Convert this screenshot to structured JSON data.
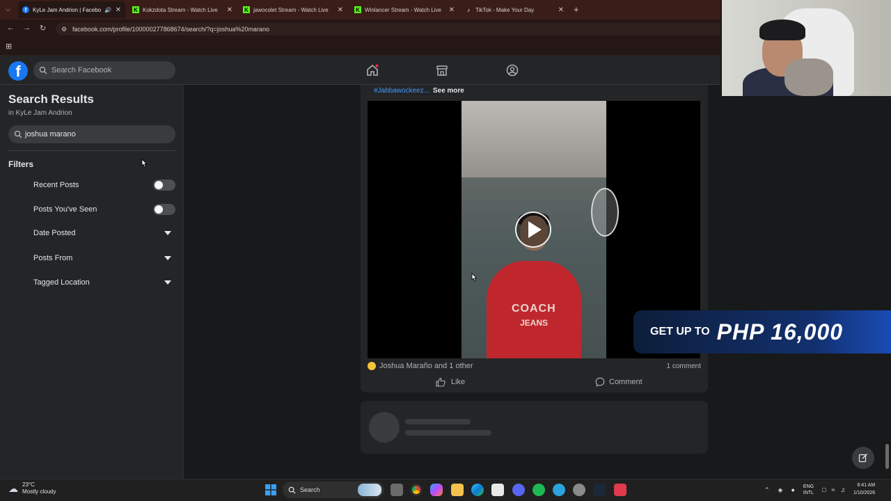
{
  "browser": {
    "tabs": [
      {
        "label": "KyLe Jam Andrion | Facebo",
        "active": true,
        "icon": "facebook-icon"
      },
      {
        "label": "Kokzdota Stream - Watch Live",
        "active": false,
        "icon": "kick-icon"
      },
      {
        "label": "jawocolet Stream - Watch Live",
        "active": false,
        "icon": "kick-icon"
      },
      {
        "label": "Winlancer Stream - Watch Live",
        "active": false,
        "icon": "kick-icon"
      },
      {
        "label": "TikTok - Make Your Day",
        "active": false,
        "icon": "tiktok-icon"
      }
    ],
    "new_tab": "+",
    "url": "facebook.com/profile/100000277868674/search/?q=joshua%20marano"
  },
  "header": {
    "logo": "f",
    "search_placeholder": "Search Facebook"
  },
  "sidebar": {
    "title": "Search Results",
    "subtitle": "in KyLe Jam Andrion",
    "search_value": "joshua marano",
    "filters_heading": "Filters",
    "filters": [
      {
        "label": "Recent Posts",
        "type": "toggle",
        "on": false
      },
      {
        "label": "Posts You've Seen",
        "type": "toggle",
        "on": false
      },
      {
        "label": "Date Posted",
        "type": "dropdown"
      },
      {
        "label": "Posts From",
        "type": "dropdown"
      },
      {
        "label": "Tagged Location",
        "type": "dropdown"
      }
    ]
  },
  "post": {
    "hashtag": "#Jabbawockeez...",
    "see_more": "See more",
    "video_shirt_text_1": "COACH",
    "video_shirt_text_2": "JEANS",
    "reactions": "Joshua Maraño and 1 other",
    "comments": "1 comment",
    "like_label": "Like",
    "comment_label": "Comment"
  },
  "ad": {
    "prefix": "GET UP TO",
    "amount": "PHP 16,000"
  },
  "taskbar": {
    "weather_temp": "23°C",
    "weather_desc": "Mostly cloudy",
    "search_label": "Search",
    "lang_1": "ENG",
    "lang_2": "INTL",
    "time": "6:41 AM",
    "date": "1/10/2026"
  },
  "colors": {
    "accent": "#1877f2",
    "tab_bar": "#3a1d18",
    "fb_surface": "#242526",
    "fb_bg": "#18191a",
    "hashtag": "#4599ff"
  }
}
